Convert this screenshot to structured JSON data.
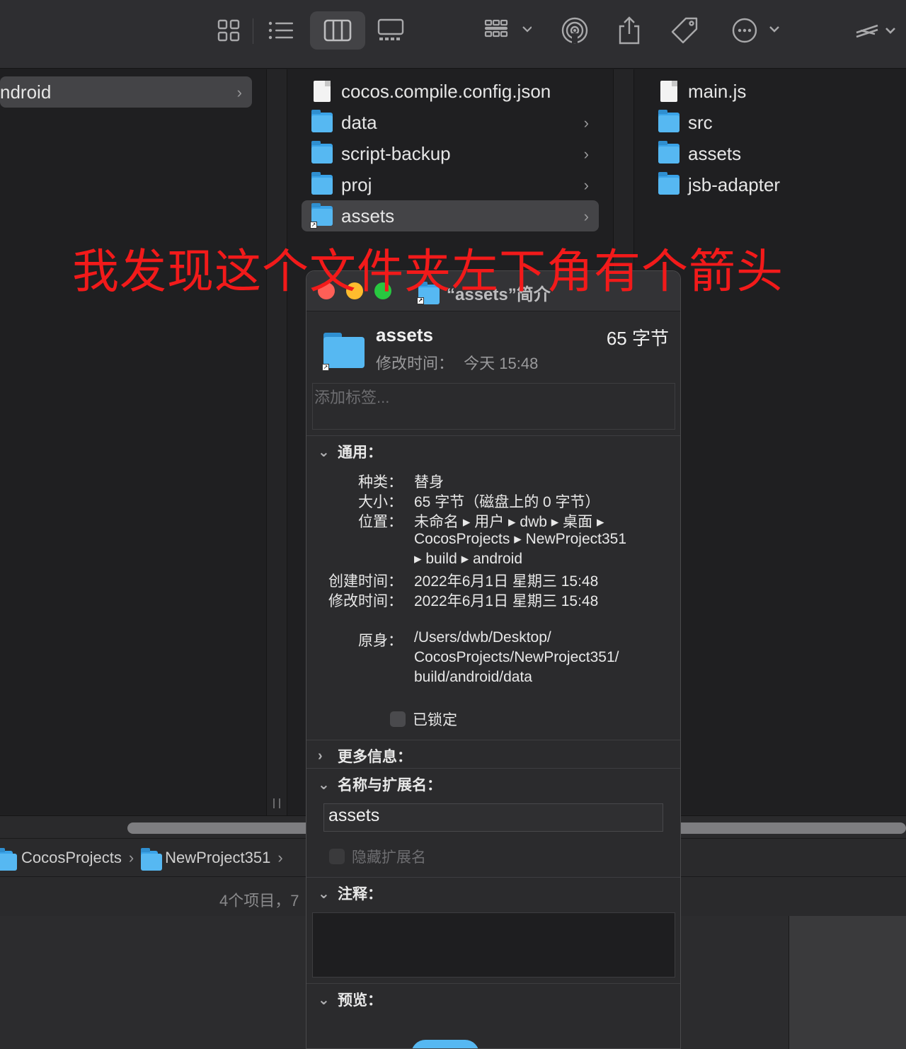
{
  "toolbar": {
    "icons": [
      "icon-view-icon",
      "list-view-icon",
      "column-view-icon",
      "gallery-view-icon",
      "group-icon",
      "airdrop-icon",
      "share-icon",
      "tag-icon",
      "more-icon",
      "scripts-icon"
    ]
  },
  "columns": {
    "col1": [
      {
        "label": "ndroid",
        "type": "folder",
        "selected": true
      }
    ],
    "col2": [
      {
        "label": "cocos.compile.config.json",
        "type": "file"
      },
      {
        "label": "data",
        "type": "folder"
      },
      {
        "label": "script-backup",
        "type": "folder"
      },
      {
        "label": "proj",
        "type": "folder"
      },
      {
        "label": "assets",
        "type": "alias",
        "selected": true
      }
    ],
    "col3": [
      {
        "label": "main.js",
        "type": "js-file"
      },
      {
        "label": "src",
        "type": "folder"
      },
      {
        "label": "assets",
        "type": "folder"
      },
      {
        "label": "jsb-adapter",
        "type": "folder"
      }
    ]
  },
  "pathbar": {
    "items": [
      "CocosProjects",
      "NewProject351"
    ]
  },
  "status": {
    "text": "4个项目，7"
  },
  "annotation": {
    "text": "我发现这个文件夹左下角有个箭头"
  },
  "info": {
    "title": "“assets”简介",
    "name": "assets",
    "size": "65 字节",
    "modified_label": "修改时间：",
    "modified_value": "今天 15:48",
    "tags_placeholder": "添加标签...",
    "general": {
      "header": "通用：",
      "kind_label": "种类：",
      "kind_value": "替身",
      "size_label": "大小：",
      "size_value": "65 字节（磁盘上的 0 字节）",
      "where_label": "位置：",
      "where_value_1": "未命名 ▸ 用户 ▸ dwb ▸ 桌面 ▸",
      "where_value_2": "CocosProjects ▸ NewProject351",
      "where_value_3": "▸ build ▸ android",
      "created_label": "创建时间：",
      "created_value": "2022年6月1日 星期三 15:48",
      "modified_label": "修改时间：",
      "modified_value": "2022年6月1日 星期三 15:48",
      "original_label": "原身：",
      "original_value_1": "/Users/dwb/Desktop/",
      "original_value_2": "CocosProjects/NewProject351/",
      "original_value_3": "build/android/data",
      "locked_label": "已锁定"
    },
    "more_info_header": "更多信息：",
    "name_ext": {
      "header": "名称与扩展名：",
      "value": "assets",
      "hide_ext_label": "隐藏扩展名"
    },
    "comments_header": "注释：",
    "preview_header": "预览："
  },
  "colors": {
    "accent_folder": "#56b8f2",
    "annotation": "#f21a1a",
    "close": "#ff5f57",
    "minimize": "#febc2e",
    "zoom": "#28c840"
  }
}
